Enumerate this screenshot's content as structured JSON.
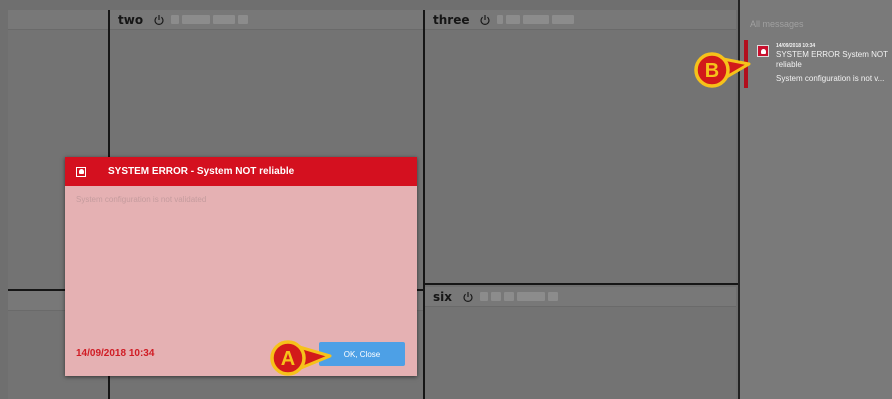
{
  "panels": [
    {
      "title": "two"
    },
    {
      "title": "three"
    },
    {
      "title": "six"
    }
  ],
  "messages": {
    "header": "All messages",
    "items": [
      {
        "time": "14/09/2018 10:34",
        "title": "SYSTEM ERROR System NOT reliable",
        "description": "System configuration is not v..."
      }
    ]
  },
  "dialog": {
    "title": "SYSTEM ERROR - System NOT reliable",
    "body": "System configuration is not validated",
    "date": "14/09/2018 10:34",
    "ok_label": "OK, Close"
  },
  "callouts": {
    "a": "A",
    "b": "B"
  },
  "colors": {
    "error_red": "#d4101f",
    "dialog_bg": "#e5b1b3",
    "ok_blue": "#4da0e6",
    "callout_yellow": "#f6c21a",
    "callout_red": "#d21a1a"
  },
  "icons": {
    "power": "power-icon",
    "alarm": "alarm-bell-icon"
  }
}
